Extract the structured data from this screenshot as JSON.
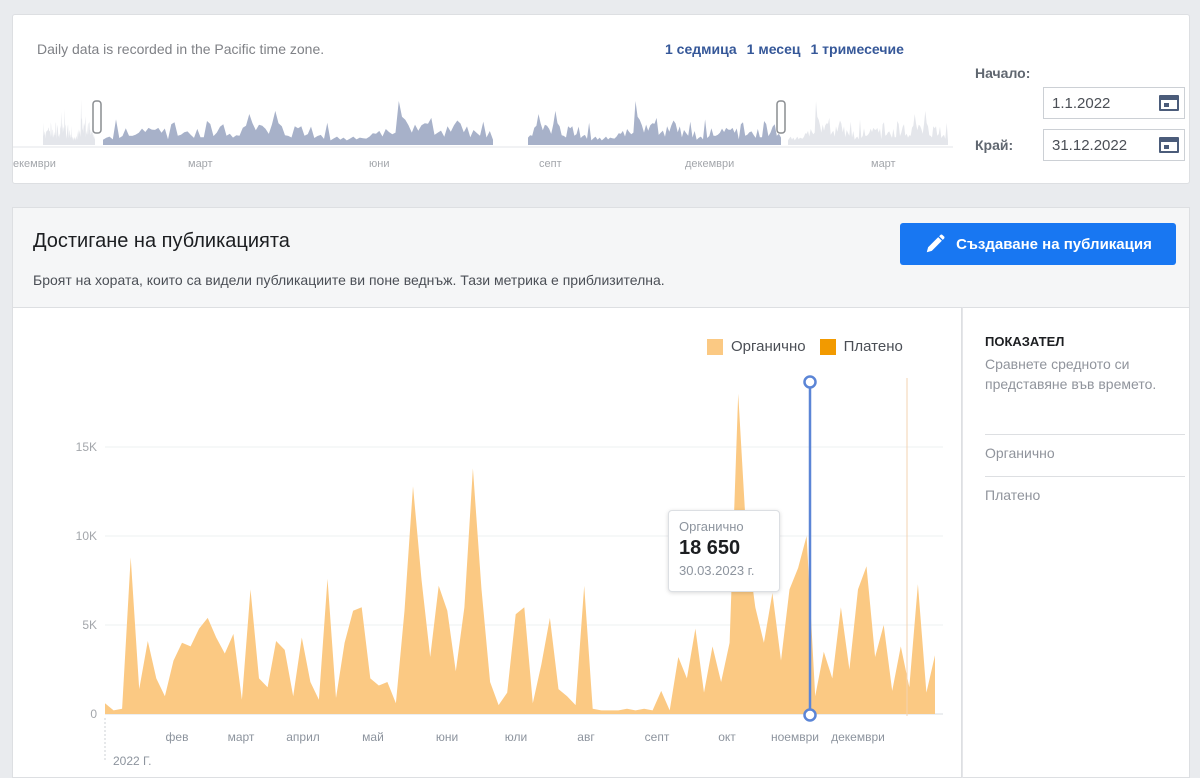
{
  "range": {
    "note": "Daily data is recorded in the Pacific time zone.",
    "links": [
      "1 седмица",
      "1 месец",
      "1 тримесечие"
    ],
    "timeline_labels": [
      "екември",
      "март",
      "юни",
      "септ",
      "декември",
      "март"
    ],
    "start_label": "Начало:",
    "start_value": "1.1.2022",
    "end_label": "Край:",
    "end_value": "31.12.2022"
  },
  "section": {
    "title": "Достигане на публикацията",
    "description": "Броят на хората, които са видели публикациите ви поне веднъж. Тази метрика е приблизителна.",
    "create_button": "Създаване на публикация"
  },
  "legend": {
    "organic": "Органично",
    "paid": "Платено",
    "organic_color": "#fbc983",
    "paid_color": "#f29a00"
  },
  "tooltip": {
    "label": "Органично",
    "value": "18 650",
    "date": "30.03.2023 г."
  },
  "side": {
    "title": "ПОКАЗАТЕЛ",
    "description": "Сравнете средното си представяне във времето.",
    "items": [
      "Органично",
      "Платено"
    ]
  },
  "chart_data": {
    "type": "area",
    "y_ticks": [
      "0",
      "5K",
      "10K",
      "15K"
    ],
    "ylim": [
      0,
      20000
    ],
    "x_ticks": [
      "фев",
      "март",
      "април",
      "май",
      "юни",
      "юли",
      "авг",
      "септ",
      "окт",
      "ноември",
      "декември"
    ],
    "x_sublabel": "2022 Г.",
    "series": [
      {
        "name": "Органично",
        "values": [
          600,
          200,
          300,
          8800,
          1400,
          4100,
          2000,
          1000,
          3000,
          4000,
          3800,
          4800,
          5400,
          4300,
          3400,
          4500,
          800,
          7000,
          2000,
          1500,
          4100,
          3600,
          1000,
          4300,
          1800,
          800,
          7600,
          900,
          4000,
          5800,
          6000,
          2000,
          1600,
          1800,
          600,
          5800,
          12800,
          7500,
          3200,
          7200,
          5800,
          2400,
          6000,
          13800,
          7000,
          1800,
          500,
          1200,
          5600,
          6000,
          600,
          2800,
          5400,
          1400,
          1000,
          500,
          7200,
          300,
          200,
          200,
          200,
          300,
          200,
          300,
          200,
          1300,
          200,
          3200,
          2000,
          4800,
          1200,
          3800,
          1800,
          4000,
          18000,
          9600,
          6000,
          4000,
          6800,
          3000,
          7000,
          8200,
          10000,
          1000,
          3500,
          2000,
          6000,
          2500,
          7000,
          8300,
          3200,
          5000,
          1300,
          3800,
          1500,
          7300,
          1200,
          3300
        ]
      },
      {
        "name": "Платено",
        "values": []
      }
    ]
  }
}
